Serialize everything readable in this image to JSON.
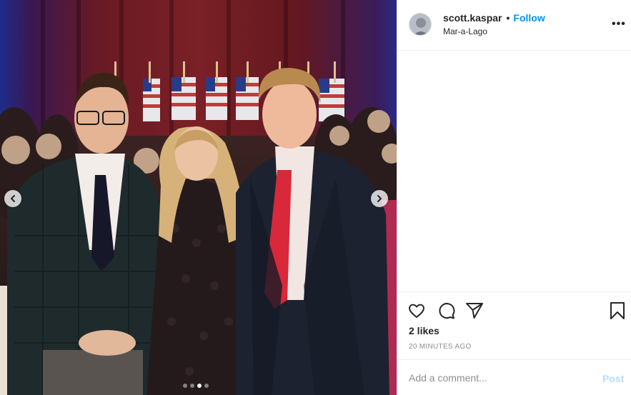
{
  "post": {
    "username": "scott.kaspar",
    "separator": "•",
    "follow_label": "Follow",
    "location": "Mar-a-Lago",
    "more_label": "•••",
    "likes": "2 likes",
    "timestamp": "20 MINUTES AGO"
  },
  "photo": {
    "carousel_count": 4,
    "carousel_active_index": 2,
    "prev_icon": "chevron-left-icon",
    "next_icon": "chevron-right-icon"
  },
  "actions": {
    "like_icon": "heart-icon",
    "comment_icon": "comment-icon",
    "share_icon": "paper-plane-icon",
    "save_icon": "bookmark-icon"
  },
  "comment": {
    "placeholder": "Add a comment...",
    "post_label": "Post"
  },
  "colors": {
    "accent": "#0095f6",
    "post_disabled": "#b2dffc",
    "text_primary": "#262626",
    "text_secondary": "#8e8e8e"
  }
}
